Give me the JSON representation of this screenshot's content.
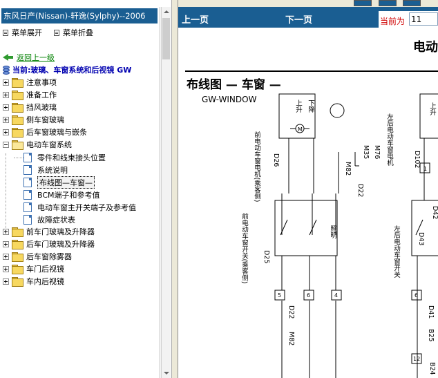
{
  "left_pane": {
    "title": "东风日产(Nissan)-轩逸(Sylphy)--2006",
    "expand_label": "菜单展开",
    "collapse_label": "菜单折叠",
    "back_label": "返回上一级",
    "current_label": "当前:玻璃、车窗系统和后视镜 GW",
    "tree": [
      {
        "label": "注意事项",
        "state": "collapsed"
      },
      {
        "label": "准备工作",
        "state": "collapsed"
      },
      {
        "label": "挡风玻璃",
        "state": "collapsed"
      },
      {
        "label": "侧车窗玻璃",
        "state": "collapsed"
      },
      {
        "label": "后车窗玻璃与嵌条",
        "state": "collapsed"
      },
      {
        "label": "电动车窗系统",
        "state": "expanded"
      },
      {
        "label": "前车门玻璃及升降器",
        "state": "collapsed"
      },
      {
        "label": "后车门玻璃及升降器",
        "state": "collapsed"
      },
      {
        "label": "后车窗除雾器",
        "state": "collapsed"
      },
      {
        "label": "车门后视镜",
        "state": "collapsed"
      },
      {
        "label": "车内后视镜",
        "state": "collapsed"
      }
    ],
    "children": [
      {
        "label": "零件和线束接头位置"
      },
      {
        "label": "系统说明"
      },
      {
        "label": "布线图—车窗—",
        "selected": true
      },
      {
        "label": "BCM端子和参考值"
      },
      {
        "label": "电动车窗主开关端子及参考值"
      },
      {
        "label": "故障症状表"
      }
    ]
  },
  "nav": {
    "prev_label": "上一页",
    "next_label": "下一页",
    "current_page_label": "当前为",
    "current_page_value": "11"
  },
  "document": {
    "header_partial": "电动",
    "title": "布线图 — 车窗 —",
    "diagram_code": "GW-WINDOW",
    "labels": {
      "motor_front": "前电动车窗电机(乘客侧)",
      "motor_rear_left": "左后电动车窗电机",
      "switch_front": "前电动车窗开关(乘客侧)",
      "switch_rear_left": "左后电动车窗开关",
      "up": "上升",
      "down": "下降",
      "light": "照明",
      "d26": "D26",
      "d25": "D25",
      "d22": "D22",
      "m82": "M82",
      "m35": "M35",
      "m76": "M76",
      "d102": "D102",
      "d43": "D43",
      "d41": "D41",
      "b25": "B25",
      "b24": "B24",
      "d42": "D42"
    }
  }
}
